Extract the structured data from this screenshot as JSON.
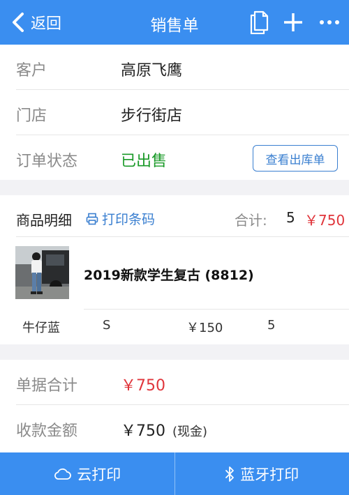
{
  "nav": {
    "back_label": "返回",
    "title": "销售单",
    "icons": [
      "document-icon",
      "plus-icon",
      "more-icon"
    ],
    "bg_color": "#3a8ef0"
  },
  "info": {
    "customer_label": "客户",
    "customer_value": "高原飞鹰",
    "store_label": "门店",
    "store_value": "步行街店",
    "status_label": "订单状态",
    "status_value": "已出售",
    "status_color": "#1a9a28",
    "view_outbound_button": "查看出库单"
  },
  "details": {
    "title": "商品明细",
    "print_barcode_label": "打印条码",
    "total_label": "合计:",
    "total_qty": "5",
    "total_amount": "￥750",
    "items": [
      {
        "name": "2019新款学生复古 (8812)",
        "color": "牛仔蓝",
        "size": "S",
        "price": "￥150",
        "qty": "5"
      }
    ]
  },
  "summary": {
    "bill_total_label": "单据合计",
    "bill_total_value": "￥750",
    "received_label": "收款金额",
    "received_value": "￥750",
    "received_method": "(现金)"
  },
  "bottom": {
    "cloud_print_label": "云打印",
    "bluetooth_print_label": "蓝牙打印"
  }
}
